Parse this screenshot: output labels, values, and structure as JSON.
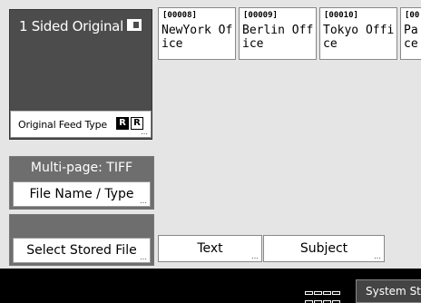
{
  "left_panel": {
    "original_title": "1 Sided Original",
    "feed_label": "Original Feed Type",
    "feed_icon_1": "R",
    "feed_icon_2": "R"
  },
  "multipage_group": {
    "header": "Multi-page: TIFF",
    "button_label": "File Name / Type"
  },
  "stored_group": {
    "header": "",
    "button_label": "Select Stored File"
  },
  "files": [
    {
      "number": "[00008]",
      "name": "NewYork Of\nice"
    },
    {
      "number": "[00009]",
      "name": "Berlin Off\nice"
    },
    {
      "number": "[00010]",
      "name": "Tokyo Offi\nce"
    },
    {
      "number": "[00",
      "name": "Pa\nce"
    }
  ],
  "bottom": {
    "text_label": "Text",
    "subject_label": "Subject"
  },
  "status": {
    "system_status_label": "System Stat"
  },
  "icons": {
    "original_icon": "one-sided-original-icon",
    "feed_type_icon": "feed-orientation-icon",
    "memory_indicator": "memory-indicator-icon"
  }
}
